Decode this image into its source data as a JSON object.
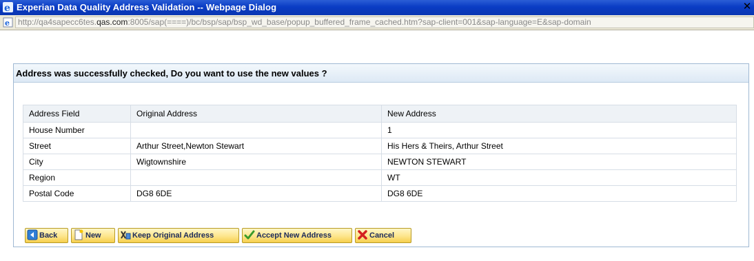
{
  "window": {
    "title": "Experian Data Quality Address Validation -- Webpage Dialog",
    "close_glyph": "✕"
  },
  "address_bar": {
    "url_prefix": "http://qa4sapecc6tes.",
    "url_host": "qas.com",
    "url_suffix": ":8005/sap(====)/bc/bsp/sap/bsp_wd_base/popup_buffered_frame_cached.htm?sap-client=001&sap-language=E&sap-domain"
  },
  "panel": {
    "heading": "Address was successfully checked, Do you want to use the new values ?"
  },
  "table": {
    "headers": [
      "Address Field",
      "Original Address",
      "New Address"
    ],
    "rows": [
      [
        "House Number",
        "",
        "1"
      ],
      [
        "Street",
        "Arthur Street,Newton Stewart",
        "His Hers & Theirs, Arthur Street"
      ],
      [
        "City",
        "Wigtownshire",
        "NEWTON STEWART"
      ],
      [
        "Region",
        "",
        "WT"
      ],
      [
        "Postal Code",
        "DG8 6DE",
        "DG8 6DE"
      ]
    ]
  },
  "buttons": {
    "back": "Back",
    "new": "New",
    "keep": "Keep Original Address",
    "accept": "Accept New Address",
    "cancel": "Cancel"
  },
  "icons": {
    "title": "ie-icon",
    "page": "ie-page-icon",
    "back": "back-arrow-icon",
    "new": "new-document-icon",
    "keep": "keep-address-icon",
    "accept": "checkmark-icon",
    "cancel": "red-x-icon"
  },
  "colors": {
    "titlebar": "#0a3cc4",
    "panel_border": "#9fb8d3",
    "button_fill": "#fde58b",
    "cancel_icon": "#d42020",
    "accept_icon": "#3a9a2a"
  }
}
